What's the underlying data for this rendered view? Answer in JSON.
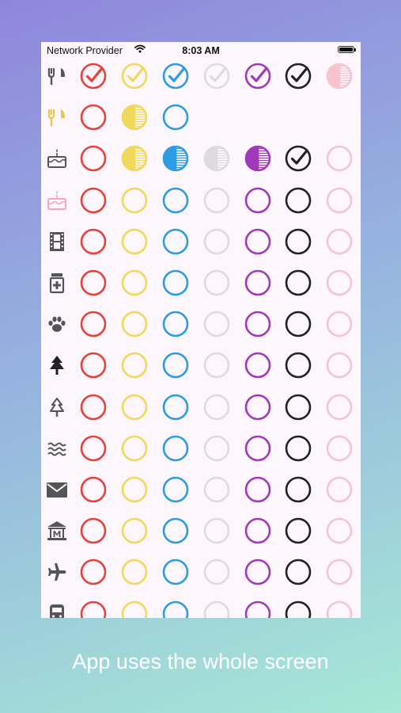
{
  "status_bar": {
    "carrier": "Network Provider",
    "time": "8:03 AM"
  },
  "caption": "App uses the whole screen",
  "colors": [
    "#e8413c",
    "#f2d85a",
    "#2d9be6",
    "#dddbe0",
    "#a13ab8",
    "#222222",
    "#f6c3cf"
  ],
  "rows": [
    {
      "icon": "fork-knife-icon",
      "icon_color": "#555555",
      "cells": [
        "check",
        "check",
        "check",
        "check",
        "check",
        "check",
        "half"
      ]
    },
    {
      "icon": "fork-knife-icon",
      "icon_color": "#e8c84a",
      "cells": [
        "empty",
        "half",
        "empty",
        null,
        null,
        null,
        null
      ]
    },
    {
      "icon": "birthday-cake-icon",
      "icon_color": "#555555",
      "cells": [
        "empty",
        "half",
        "half",
        "half",
        "half",
        "check",
        "empty"
      ]
    },
    {
      "icon": "birthday-cake-icon",
      "icon_color": "#f5a8bb",
      "cells": [
        "empty",
        "empty",
        "empty",
        "empty",
        "empty",
        "empty",
        "empty"
      ]
    },
    {
      "icon": "film-strip-icon",
      "icon_color": "#555555",
      "cells": [
        "empty",
        "empty",
        "empty",
        "empty",
        "empty",
        "empty",
        "empty"
      ]
    },
    {
      "icon": "medicine-bottle-icon",
      "icon_color": "#555555",
      "cells": [
        "empty",
        "empty",
        "empty",
        "empty",
        "empty",
        "empty",
        "empty"
      ]
    },
    {
      "icon": "paw-icon",
      "icon_color": "#555555",
      "cells": [
        "empty",
        "empty",
        "empty",
        "empty",
        "empty",
        "empty",
        "empty"
      ]
    },
    {
      "icon": "tree-icon",
      "icon_color": "#222222",
      "cells": [
        "empty",
        "empty",
        "empty",
        "empty",
        "empty",
        "empty",
        "empty"
      ]
    },
    {
      "icon": "tree-outline-icon",
      "icon_color": "#555555",
      "cells": [
        "empty",
        "empty",
        "empty",
        "empty",
        "empty",
        "empty",
        "empty"
      ]
    },
    {
      "icon": "waves-icon",
      "icon_color": "#555555",
      "cells": [
        "empty",
        "empty",
        "empty",
        "empty",
        "empty",
        "empty",
        "empty"
      ]
    },
    {
      "icon": "envelope-icon",
      "icon_color": "#555555",
      "cells": [
        "empty",
        "empty",
        "empty",
        "empty",
        "empty",
        "empty",
        "empty"
      ]
    },
    {
      "icon": "museum-icon",
      "icon_color": "#555555",
      "cells": [
        "empty",
        "empty",
        "empty",
        "empty",
        "empty",
        "empty",
        "empty"
      ]
    },
    {
      "icon": "airplane-icon",
      "icon_color": "#555555",
      "cells": [
        "empty",
        "empty",
        "empty",
        "empty",
        "empty",
        "empty",
        "empty"
      ]
    },
    {
      "icon": "train-icon",
      "icon_color": "#555555",
      "cells": [
        "empty",
        "empty",
        "empty",
        "empty",
        "empty",
        "empty",
        "empty"
      ]
    }
  ]
}
